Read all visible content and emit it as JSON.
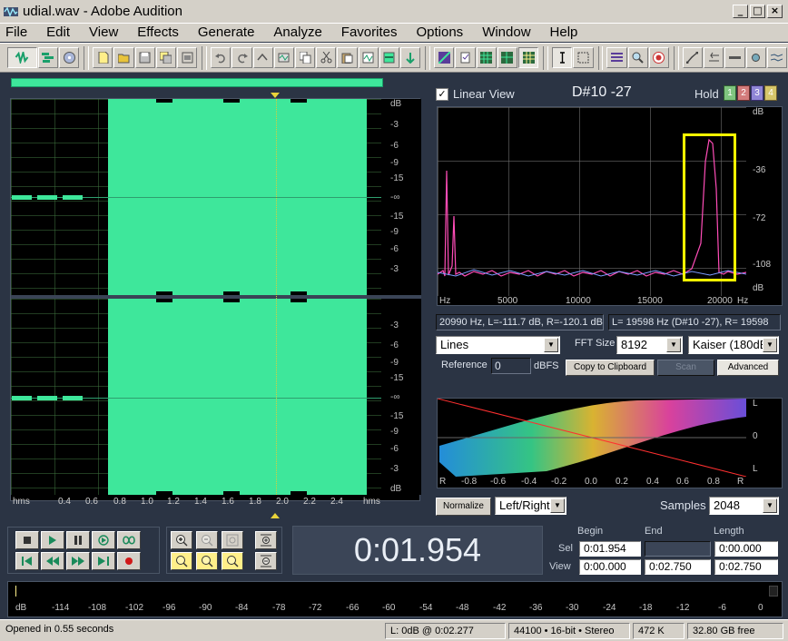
{
  "window": {
    "title": "udial.wav - Adobe Audition",
    "controls": [
      "_",
      "□",
      "×"
    ]
  },
  "menu": [
    "File",
    "Edit",
    "View",
    "Effects",
    "Generate",
    "Analyze",
    "Favorites",
    "Options",
    "Window",
    "Help"
  ],
  "waveform": {
    "db_labels_top": [
      "dB",
      "-3",
      "-6",
      "-9",
      "-15",
      "-∞",
      "-15",
      "-9",
      "-6",
      "-3"
    ],
    "db_labels_bottom": [
      "-3",
      "-6",
      "-9",
      "-15",
      "-∞",
      "-15",
      "-9",
      "-6",
      "-3",
      "dB"
    ],
    "time_labels": [
      "hms",
      "0.4",
      "0.6",
      "0.8",
      "1.0",
      "1.2",
      "1.4",
      "1.6",
      "1.8",
      "2.0",
      "2.2",
      "2.4",
      "hms"
    ]
  },
  "freq_panel": {
    "linear_view_label": "Linear View",
    "note": "D#10 -27",
    "hold_label": "Hold",
    "hold_buttons": [
      "1",
      "2",
      "3",
      "4"
    ],
    "y_labels": [
      "dB",
      "-36",
      "-72",
      "-108",
      "dB"
    ],
    "x_labels": [
      "Hz",
      "5000",
      "10000",
      "15000",
      "20000",
      "Hz"
    ],
    "readout_left": "20990 Hz, L=-111.7 dB, R=-120.1 dB",
    "readout_right": "L= 19598 Hz (D#10 -27), R= 19598",
    "display_mode": "Lines",
    "fft_label": "FFT Size",
    "fft_size": "8192",
    "window_func": "Kaiser (180dB",
    "reference_label": "Reference",
    "reference_value": "0",
    "dbfs_label": "dBFS",
    "copy_button": "Copy to Clipboard",
    "scan_button": "Scan",
    "advanced_button": "Advanced"
  },
  "phase_panel": {
    "right_labels": [
      "L",
      "0",
      "L"
    ],
    "x_labels": [
      "R",
      "-0.8",
      "-0.6",
      "-0.4",
      "-0.2",
      "0.0",
      "0.2",
      "0.4",
      "0.6",
      "0.8",
      "R"
    ],
    "normalize_button": "Normalize",
    "channel_mode": "Left/Right",
    "samples_label": "Samples",
    "samples_value": "2048"
  },
  "time_display": "0:01.954",
  "selview": {
    "headers": [
      "Begin",
      "End",
      "Length"
    ],
    "sel_label": "Sel",
    "view_label": "View",
    "sel": [
      "0:01.954",
      "",
      "0:00.000"
    ],
    "view": [
      "0:00.000",
      "0:02.750",
      "0:02.750"
    ]
  },
  "levels": {
    "ticks": [
      "dB",
      "-114",
      "-108",
      "-102",
      "-96",
      "-90",
      "-84",
      "-78",
      "-72",
      "-66",
      "-60",
      "-54",
      "-48",
      "-42",
      "-36",
      "-30",
      "-24",
      "-18",
      "-12",
      "-6",
      "0"
    ]
  },
  "status": {
    "message": "Opened in 0.55 seconds",
    "level": "L: 0dB @  0:02.277",
    "format": "44100 • 16-bit • Stereo",
    "size": "472 K",
    "free": "32.80 GB free"
  },
  "colors": {
    "waveform": "#3ee79b",
    "highlight_box": "#ffff00",
    "spectrum_line": "#ff4db8",
    "panel_bg": "#2b3444"
  }
}
